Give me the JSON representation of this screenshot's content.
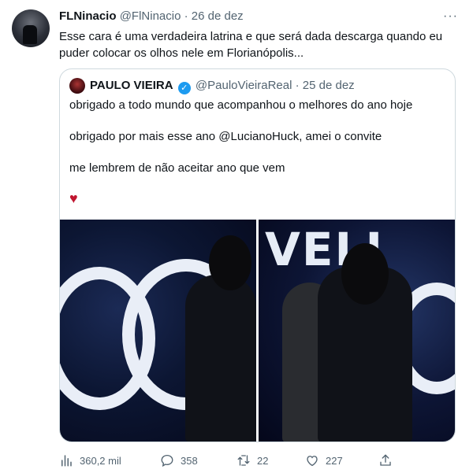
{
  "tweet": {
    "author_name": "FLNinacio",
    "author_handle": "@FlNinacio",
    "separator": "·",
    "date": "26 de dez",
    "more_label": "···",
    "text": "Esse cara é uma verdadeira latrina e que será dada descarga quando eu puder colocar os olhos nele em Florianópolis..."
  },
  "quoted": {
    "author_name": "PAULO VIEIRA",
    "author_handle": "@PauloVieiraReal",
    "separator": "·",
    "date": "25 de dez",
    "lines": [
      "obrigado a todo mundo que acompanhou o melhores do ano hoje",
      "obrigado por mais esse ano @LucianoHuck, amei o convite",
      "me lembrem de não aceitar ano que vem"
    ],
    "heart_emoji": "♥",
    "verified_mark": "✓",
    "stage_letters_right": "VELI"
  },
  "actions": {
    "views": "360,2 mil",
    "replies": "358",
    "retweets": "22",
    "likes": "227"
  },
  "colors": {
    "text": "#0f1419",
    "secondary": "#536471",
    "verified": "#1d9bf0",
    "border": "#cfd9de",
    "heart": "#c0152f"
  }
}
